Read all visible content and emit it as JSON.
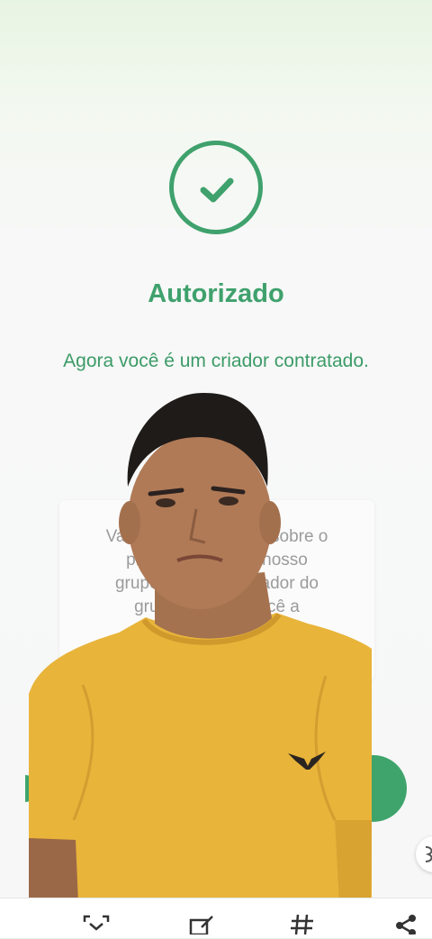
{
  "status": {
    "icon": "check-circle-icon",
    "title": "Autorizado",
    "message": "Agora você é um criador contratado."
  },
  "info_card": {
    "text": "Vamos ... des sobre o progra... r no nosso grupo ofic... nistrador do grupo t... a você a resolv..."
  },
  "overlay": {
    "description_icon": "webcam-person-overlay"
  },
  "bottom_bar": {
    "icons": [
      "scan-icon",
      "edit-icon",
      "hashtag-icon",
      "share-icon"
    ]
  },
  "colors": {
    "accent": "#3fa16c",
    "shirt": "#e8b43a",
    "background": "#f7f8f7"
  }
}
